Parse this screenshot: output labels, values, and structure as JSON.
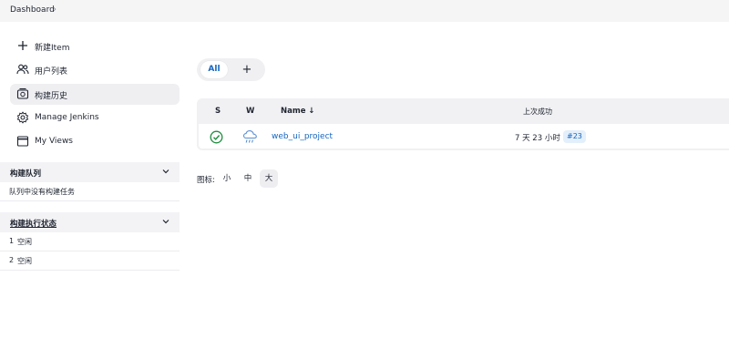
{
  "breadcrumb": {
    "root": "Dashboard"
  },
  "sidebar": {
    "items": [
      {
        "label": "新建Item",
        "icon": "plus-icon"
      },
      {
        "label": "用户列表",
        "icon": "people-icon"
      },
      {
        "label": "构建历史",
        "icon": "history-icon",
        "active": true
      },
      {
        "label": "Manage Jenkins",
        "icon": "gear-icon"
      },
      {
        "label": "My Views",
        "icon": "window-icon"
      }
    ]
  },
  "build_queue": {
    "title": "构建队列",
    "empty_text": "队列中没有构建任务"
  },
  "executors": {
    "title": "构建执行状态",
    "rows": [
      {
        "number": "1",
        "status": "空闲"
      },
      {
        "number": "2",
        "status": "空闲"
      }
    ]
  },
  "tabs": {
    "all_label": "All",
    "add_label": "+"
  },
  "table": {
    "headers": {
      "s": "S",
      "w": "W",
      "name": "Name ↓",
      "last_success": "上次成功"
    },
    "rows": [
      {
        "status": "success",
        "weather": "rainy",
        "name": "web_ui_project",
        "last_success": "7 天 23 小时",
        "build": "#23"
      }
    ]
  },
  "icon_size": {
    "label": "图标:",
    "options": [
      "小",
      "中",
      "大"
    ],
    "selected": "大"
  },
  "colors": {
    "accent": "#1565c0",
    "success": "#1e8e3e",
    "weather": "#5b8fd0"
  }
}
